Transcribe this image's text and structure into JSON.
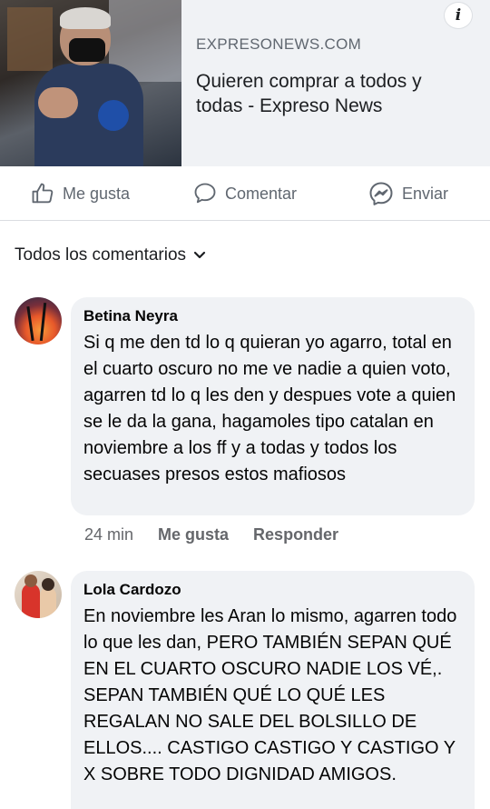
{
  "link_preview": {
    "domain": "EXPRESONEWS.COM",
    "title": "Quieren comprar a todos y todas - Expreso News",
    "info_glyph": "i"
  },
  "actions": {
    "like_label": "Me gusta",
    "comment_label": "Comentar",
    "share_label": "Enviar"
  },
  "filter": {
    "label": "Todos los comentarios"
  },
  "comments": [
    {
      "author": "Betina Neyra",
      "text": "Si q me den td lo q quieran yo agarro, total en el cuarto oscuro no me ve nadie a quien voto,  agarren td lo q les den y despues vote a quien se le da la gana, hagamoles tipo catalan en noviembre a los ff y a todas y todos los secuases presos estos mafiosos",
      "time": "24 min",
      "like_label": "Me gusta",
      "reply_label": "Responder"
    },
    {
      "author": "Lola Cardozo",
      "text": "En noviembre les Aran lo mismo, agarren todo lo que les dan, PERO TAMBIÉN SEPAN QUÉ EN EL CUARTO OSCURO NADIE LOS VÉ,.  SEPAN TAMBIÉN QUÉ LO QUÉ LES REGALAN NO SALE DEL BOLSILLO DE ELLOS.... CASTIGO CASTIGO Y CASTIGO Y X SOBRE TODO DIGNIDAD AMIGOS."
    }
  ],
  "colors": {
    "card_bg": "#f0f2f5",
    "secondary_text": "#606770",
    "primary_text": "#1c1e21"
  }
}
